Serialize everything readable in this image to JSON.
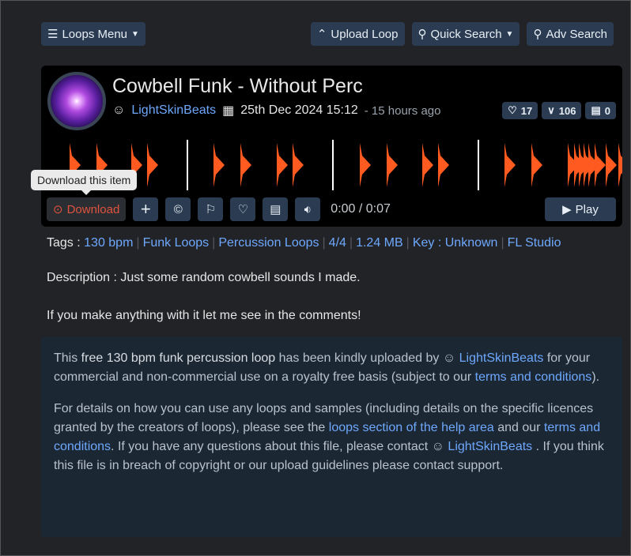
{
  "topbar": {
    "loops_menu": "Loops Menu",
    "upload": "Upload Loop",
    "quick_search": "Quick Search",
    "adv_search": "Adv Search"
  },
  "loop": {
    "title": "Cowbell Funk - Without Perc",
    "author": "LightSkinBeats",
    "date": "25th Dec 2024 15:12",
    "ago": "- 15 hours ago",
    "likes": "17",
    "downloads": "106",
    "comments": "0"
  },
  "player": {
    "download": "Download",
    "tooltip": "Download this item",
    "time": "0:00 / 0:07",
    "play": "Play",
    "waveform_color": "#ff5a1f"
  },
  "tags": {
    "label": "Tags :",
    "items": [
      "130 bpm",
      "Funk Loops",
      "Percussion Loops",
      "4/4",
      "1.24 MB",
      "Key : Unknown",
      "FL Studio"
    ]
  },
  "description": {
    "line1": "Description : Just some random cowbell sounds I made.",
    "line2": "If you make anything with it let me see in the comments!"
  },
  "info": {
    "p1_a": "This ",
    "p1_b": "free 130 bpm funk percussion loop",
    "p1_c": " has been kindly uploaded by ",
    "p1_user": "LightSkinBeats",
    "p1_d": " for your commercial and non-commercial use on a royalty free basis (subject to our ",
    "p1_link": "terms and conditions",
    "p1_e": ").",
    "p2_a": "For details on how you can use any loops and samples (including details on the specific licences granted by the creators of loops), please see the ",
    "p2_link1": "loops section of the help area",
    "p2_b": " and our ",
    "p2_link2": "terms and conditions",
    "p2_c": ". If you have any questions about this file, please contact ",
    "p2_user": "LightSkinBeats",
    "p2_d": " . If you think this file is in breach of copyright or our upload guidelines please contact support."
  }
}
